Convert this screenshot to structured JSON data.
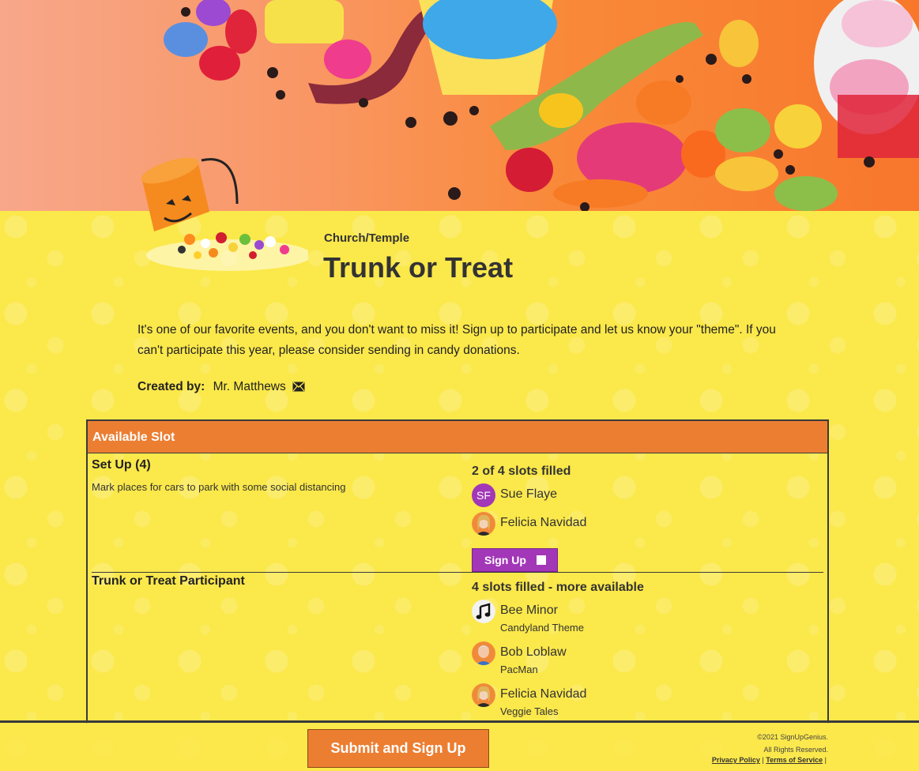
{
  "event": {
    "category": "Church/Temple",
    "title": "Trunk or Treat",
    "description": "It's one of our favorite events, and you don't want to miss it! Sign up to participate and let us know your \"theme\". If you can't participate this year, please consider sending in candy donations.",
    "created_by_label": "Created by:",
    "created_by_name": "Mr. Matthews"
  },
  "table": {
    "header": "Available Slot",
    "slots": [
      {
        "title": "Set Up (4)",
        "description": "Mark places for cars to park with some social distancing",
        "status": "2 of 4 slots filled",
        "people": [
          {
            "initials": "SF",
            "name": "Sue Flaye",
            "note": ""
          },
          {
            "name": "Felicia Navidad",
            "note": ""
          }
        ],
        "signup_label": "Sign Up"
      },
      {
        "title": "Trunk or Treat Participant",
        "status": "4 slots filled - more available",
        "people": [
          {
            "name": "Bee Minor",
            "note": "Candyland Theme"
          },
          {
            "name": "Bob Loblaw",
            "note": "PacMan"
          },
          {
            "name": "Felicia Navidad",
            "note": "Veggie Tales"
          }
        ]
      }
    ]
  },
  "footer": {
    "submit_label": "Submit and Sign Up",
    "copyright_line1": "©2021 SignUpGenius.",
    "copyright_line2": "All Rights Reserved.",
    "privacy": "Privacy Policy",
    "terms": "Terms of Service",
    "separator": "|"
  },
  "colors": {
    "accent_orange": "#ec7e32",
    "accent_purple": "#a237b7",
    "background_yellow": "#fbe84a"
  }
}
